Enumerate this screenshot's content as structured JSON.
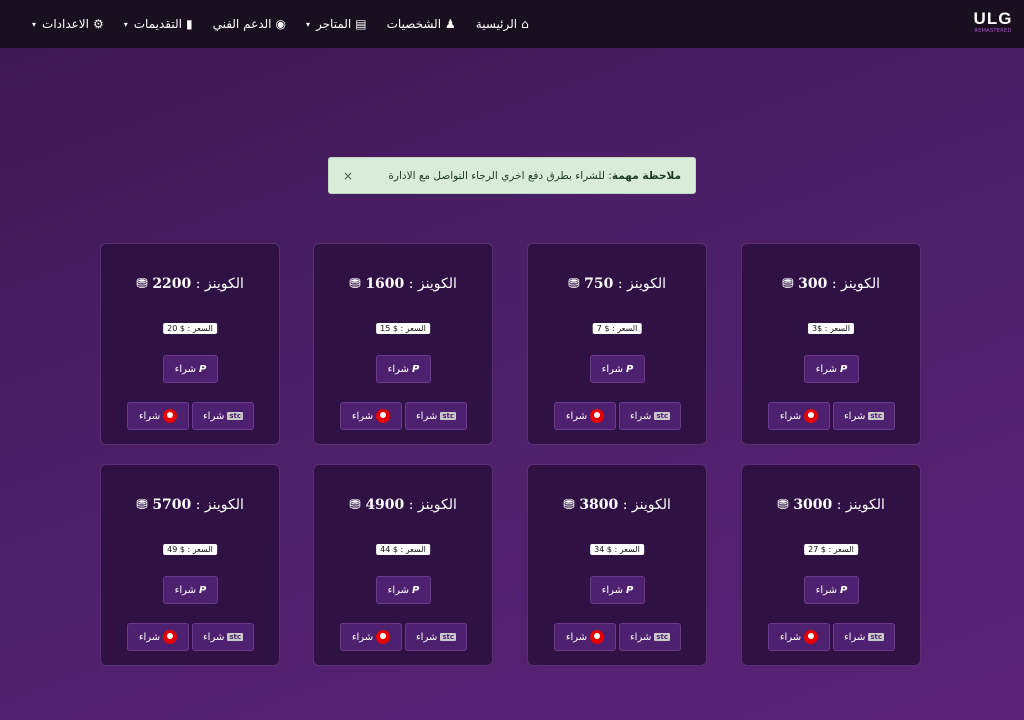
{
  "logo": {
    "main": "ULG",
    "sub": "REMASTERED"
  },
  "nav": [
    {
      "label": "الرئيسية",
      "icon": "home-icon",
      "glyph": "⌂",
      "caret": ""
    },
    {
      "label": "الشخصيات",
      "icon": "person-icon",
      "glyph": "♟",
      "caret": ""
    },
    {
      "label": "المتاجر",
      "icon": "store-icon",
      "glyph": "▤",
      "caret": "▾"
    },
    {
      "label": "الدعم الفني",
      "icon": "headset-icon",
      "glyph": "◉",
      "caret": ""
    },
    {
      "label": "التقديمات",
      "icon": "clipboard-icon",
      "glyph": "▮",
      "caret": "▾"
    },
    {
      "label": "الاعدادات",
      "icon": "gear-icon",
      "glyph": "⚙",
      "caret": "▾"
    }
  ],
  "alert": {
    "strong": "ملاحظة مهمة",
    "text": ": للشراء بطرق دفع اخري الرجاء التواصل مع الادارة",
    "close": "×"
  },
  "card_labels": {
    "title_prefix": "الكوينز :",
    "price_prefix": "السعر :",
    "buy": "شراء",
    "stc": "stc",
    "paypal": "P"
  },
  "cards": [
    {
      "coins": "300",
      "price": "$3"
    },
    {
      "coins": "750",
      "price": "$ 7"
    },
    {
      "coins": "1600",
      "price": "$ 15"
    },
    {
      "coins": "2200",
      "price": "$ 20"
    },
    {
      "coins": "3000",
      "price": "$ 27"
    },
    {
      "coins": "3800",
      "price": "$ 34"
    },
    {
      "coins": "4900",
      "price": "$ 44"
    },
    {
      "coins": "5700",
      "price": "$ 49"
    }
  ],
  "colors": {
    "accent": "#b04bd8",
    "nav_bg": "#1a0f1e",
    "card_bg": "#2f1243",
    "alert_bg": "#d8ecd9"
  }
}
